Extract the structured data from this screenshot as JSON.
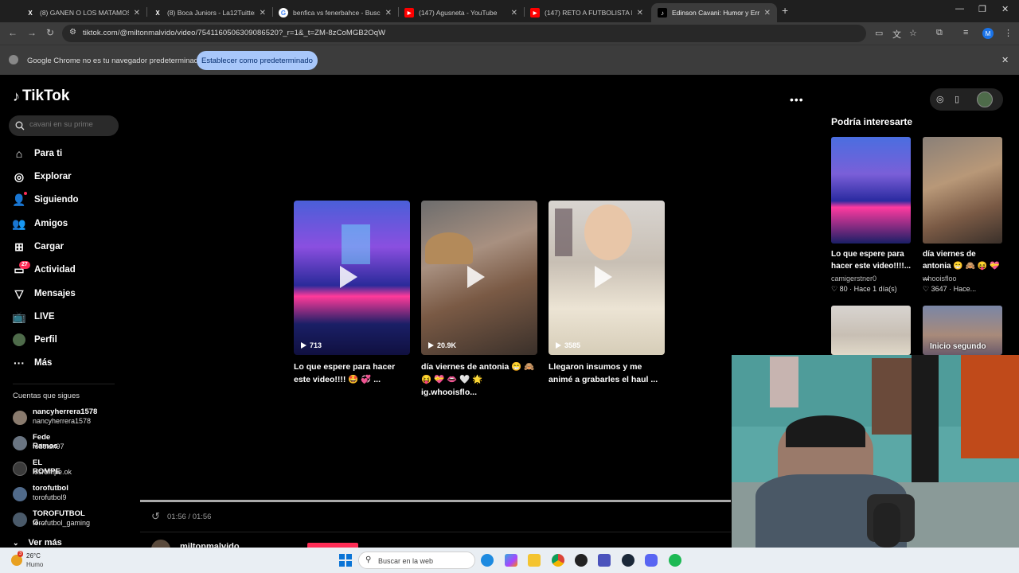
{
  "browser": {
    "tabs": [
      {
        "title": "(8) GANEN O LOS MATAMOS. #",
        "favicon": "X"
      },
      {
        "title": "(8) Boca Juniors - La12Tuittera",
        "favicon": "X"
      },
      {
        "title": "benfica vs fenerbahce - Buscar",
        "favicon": "G"
      },
      {
        "title": "(147) Agusneta - YouTube",
        "favicon": "▶"
      },
      {
        "title": "(147) RETO A FUTBOLISTA PRO",
        "favicon": "▶"
      },
      {
        "title": "Edinson Cavani: Humor y Errore",
        "favicon": "♪"
      }
    ],
    "new_tab": "+",
    "url": "tiktok.com/@miltonmalvido/video/7541160506309086520?_r=1&_t=ZM-8zCoMGB2OqW",
    "profile_initial": "M",
    "infobar_text": "Google Chrome no es tu navegador predeterminado",
    "infobar_button": "Establecer como predeterminado"
  },
  "tiktok": {
    "logo": "TikTok",
    "search_placeholder": "cavani en su prime",
    "nav": [
      {
        "label": "Para ti",
        "icon": "home-icon"
      },
      {
        "label": "Explorar",
        "icon": "compass-icon"
      },
      {
        "label": "Siguiendo",
        "icon": "following-icon"
      },
      {
        "label": "Amigos",
        "icon": "friends-icon"
      },
      {
        "label": "Cargar",
        "icon": "upload-icon"
      },
      {
        "label": "Actividad",
        "icon": "inbox-icon",
        "badge": "27"
      },
      {
        "label": "Mensajes",
        "icon": "send-icon"
      },
      {
        "label": "LIVE",
        "icon": "live-icon"
      },
      {
        "label": "Perfil",
        "icon": "avatar"
      },
      {
        "label": "Más",
        "icon": "more-icon"
      }
    ],
    "following_header": "Cuentas que sigues",
    "following": [
      {
        "name": "nancyherrera1578",
        "handle": "nancyherrera1578"
      },
      {
        "name": "Fede Ramos",
        "handle": "fedetex97"
      },
      {
        "name": "EL ROMPE",
        "handle": "losrompe.ok"
      },
      {
        "name": "torofutbol",
        "handle": "torofutbol9"
      },
      {
        "name": "TOROFUTBOL G...",
        "handle": "torofutbol_gaming"
      }
    ],
    "see_more": "Ver más",
    "videos": [
      {
        "views": "713",
        "title": "Lo que espere para hacer este video!!!! 🤩 💞 ..."
      },
      {
        "views": "20.9K",
        "title": "día viernes de antonia 😁 🙈 😝 💝 👄 🤍 🌟 ig.whooisflo..."
      },
      {
        "views": "3585",
        "title": "Llegaron insumos y me animé a grabarles el haul ..."
      }
    ],
    "time": "01:56 / 01:56",
    "author": "miltonmalvido",
    "more_dots": "•••",
    "suggest_title": "Podría interesarte",
    "suggestions": [
      {
        "title": "Lo que espere para hacer este video!!!!...",
        "user": "camigerstner0",
        "likes": "80",
        "ago": "Hace 1 día(s)"
      },
      {
        "title": "día viernes de antonia 😁 🙈 😝 💝 ...",
        "user": "whooisfloo",
        "likes": "3647",
        "ago": "Hace..."
      }
    ],
    "overlay_caption": "Inicio segundo"
  },
  "taskbar": {
    "temp": "26°C",
    "weather": "Humo",
    "weather_badge": "3",
    "search_text": "Buscar en la web"
  }
}
